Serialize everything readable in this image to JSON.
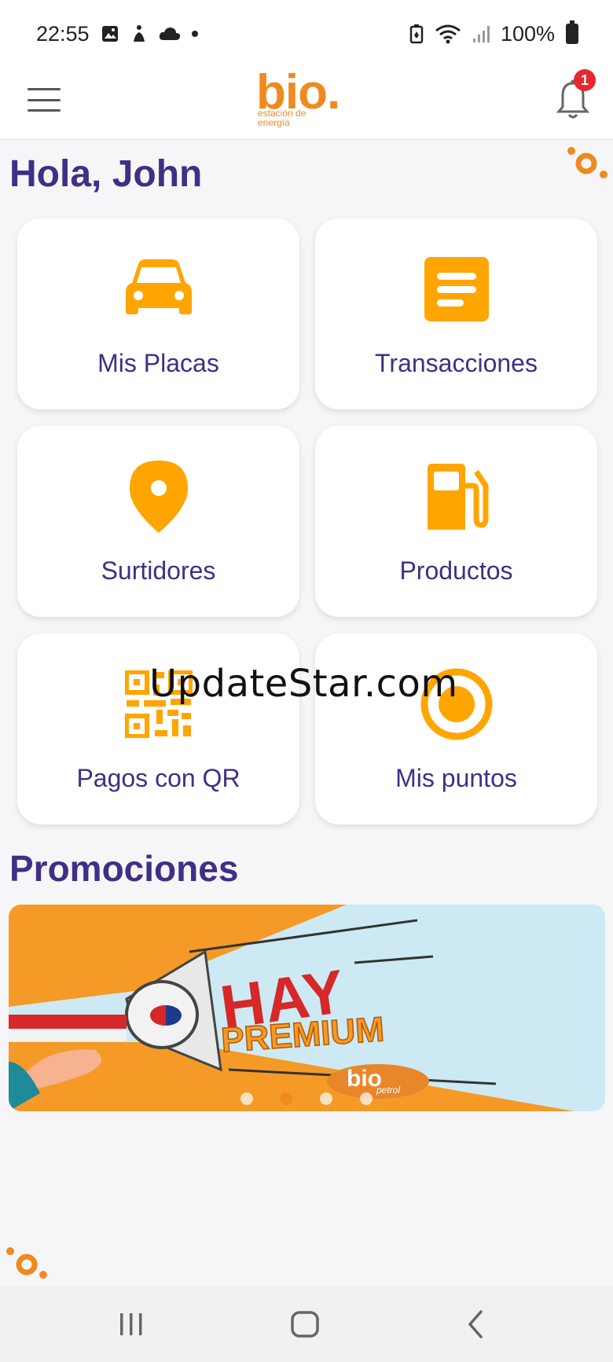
{
  "status_bar": {
    "time": "22:55",
    "battery_percent": "100%",
    "icons_left": [
      "gallery-icon",
      "accessibility-icon",
      "cloud-icon",
      "dot-icon"
    ],
    "icons_right": [
      "battery-saver-icon",
      "wifi-icon",
      "signal-icon",
      "battery-icon"
    ]
  },
  "header": {
    "menu_icon": "menu-icon",
    "logo_text": "bio.",
    "logo_subtitle": "estación de energía",
    "notification_count": "1",
    "accent_color": "#ee8a1f"
  },
  "greeting": "Hola, John",
  "tiles": [
    {
      "label": "Mis Placas",
      "icon": "car-icon"
    },
    {
      "label": "Transacciones",
      "icon": "list-document-icon"
    },
    {
      "label": "Surtidores",
      "icon": "location-pin-icon"
    },
    {
      "label": "Productos",
      "icon": "fuel-pump-icon"
    },
    {
      "label": "Pagos con QR",
      "icon": "qr-code-icon"
    },
    {
      "label": "Mis puntos",
      "icon": "target-icon"
    }
  ],
  "promotions": {
    "title": "Promociones",
    "banner": {
      "headline": "HAY",
      "subline": "PREMIUM",
      "brand": "bio",
      "brand_sub": "petrol"
    },
    "carousel_active_index": 1,
    "carousel_count": 4
  },
  "watermark": "UpdateStar.com",
  "nav_bar": [
    "recents-button",
    "home-button",
    "back-button"
  ],
  "colors": {
    "primary_text": "#3f2f86",
    "accent": "#ffa500",
    "badge": "#e8262d"
  }
}
